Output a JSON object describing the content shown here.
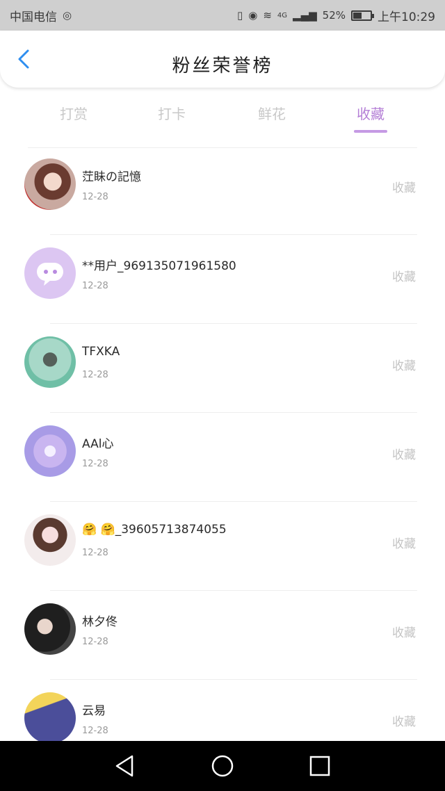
{
  "status_bar": {
    "carrier": "中国电信",
    "network": "4G",
    "battery": "52%",
    "battery_level": 0.52,
    "time": "上午10:29"
  },
  "header": {
    "title": "粉丝荣誉榜"
  },
  "tabs": [
    {
      "label": "打赏",
      "active": false
    },
    {
      "label": "打卡",
      "active": false
    },
    {
      "label": "鲜花",
      "active": false
    },
    {
      "label": "收藏",
      "active": true
    }
  ],
  "fans": [
    {
      "name": "茳眛の記憶",
      "date": "12-28",
      "action": "收藏"
    },
    {
      "name": "**用户_969135071961580",
      "date": "12-28",
      "action": "收藏"
    },
    {
      "name": "TFXKA",
      "date": "12-28",
      "action": "收藏"
    },
    {
      "name": "AAl心",
      "date": "12-28",
      "action": "收藏"
    },
    {
      "name": "🤗 🤗_396057138740​55",
      "date": "12-28",
      "action": "收藏"
    },
    {
      "name": "林夕佟",
      "date": "12-28",
      "action": "收藏"
    },
    {
      "name": "云易",
      "date": "12-28",
      "action": "收藏"
    }
  ],
  "colors": {
    "accent": "#b47fd6",
    "status_bar": "#cfcfcf",
    "nav_bar": "#000000",
    "back_arrow": "#2e8ef0"
  },
  "icons": [
    "back-arrow-icon",
    "nav-back-icon",
    "nav-home-icon",
    "nav-recents-icon"
  ]
}
